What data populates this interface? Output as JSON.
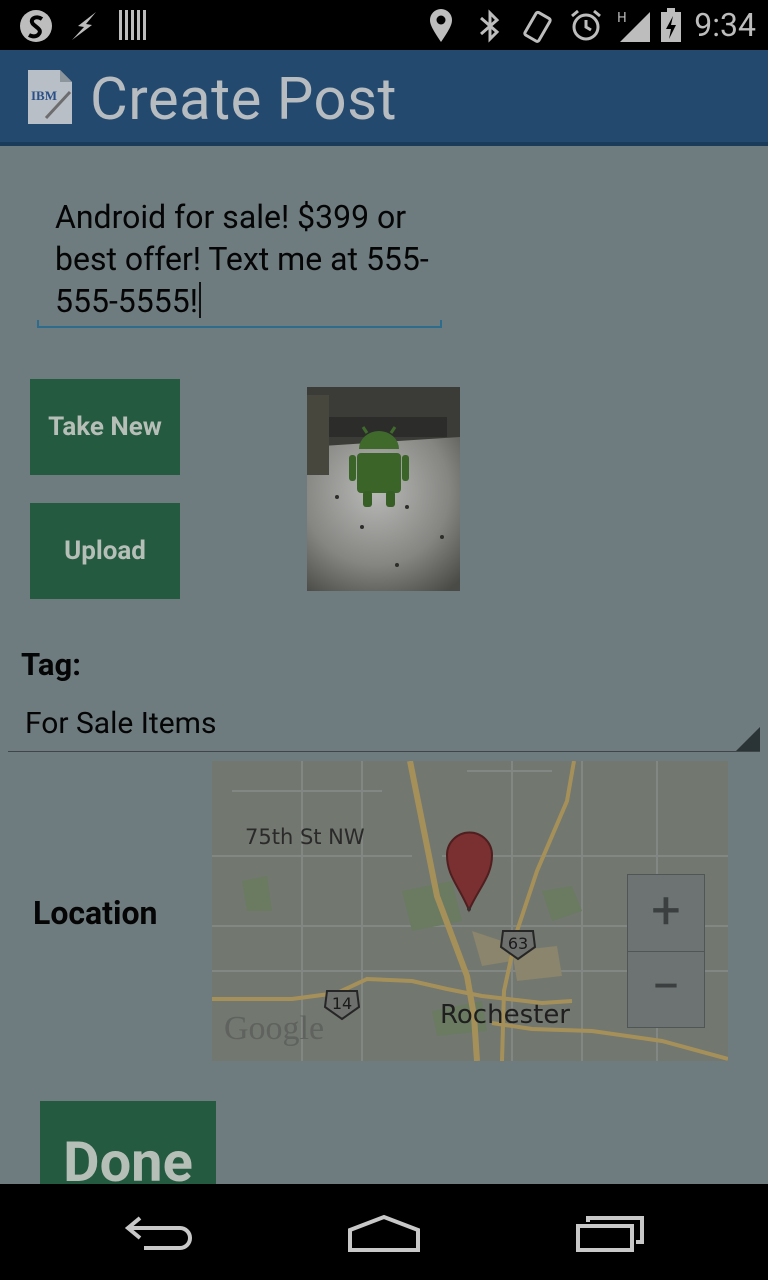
{
  "status_bar": {
    "time": "9:34"
  },
  "action_bar": {
    "title": "Create Post",
    "app_icon_text": "IBM"
  },
  "post": {
    "text": "Android for sale! $399 or best offer! Text me at 555-555-5555!"
  },
  "buttons": {
    "take_new": "Take New",
    "upload": "Upload",
    "done": "Done"
  },
  "tag": {
    "label": "Tag:",
    "selected": "For Sale Items"
  },
  "location": {
    "label": "Location",
    "map": {
      "road_label": "75th St NW",
      "city_label": "Rochester",
      "route_63": "63",
      "route_14": "14",
      "google_logo": "Google",
      "zoom_in": "+",
      "zoom_out": "−"
    }
  },
  "icons": [
    "s-icon",
    "lightning-icon",
    "barcode-icon",
    "location-icon",
    "bluetooth-icon",
    "vibrate-icon",
    "alarm-icon",
    "signal-icon",
    "battery-icon",
    "back-icon",
    "home-icon",
    "recent-apps-icon",
    "map-pin-icon"
  ]
}
